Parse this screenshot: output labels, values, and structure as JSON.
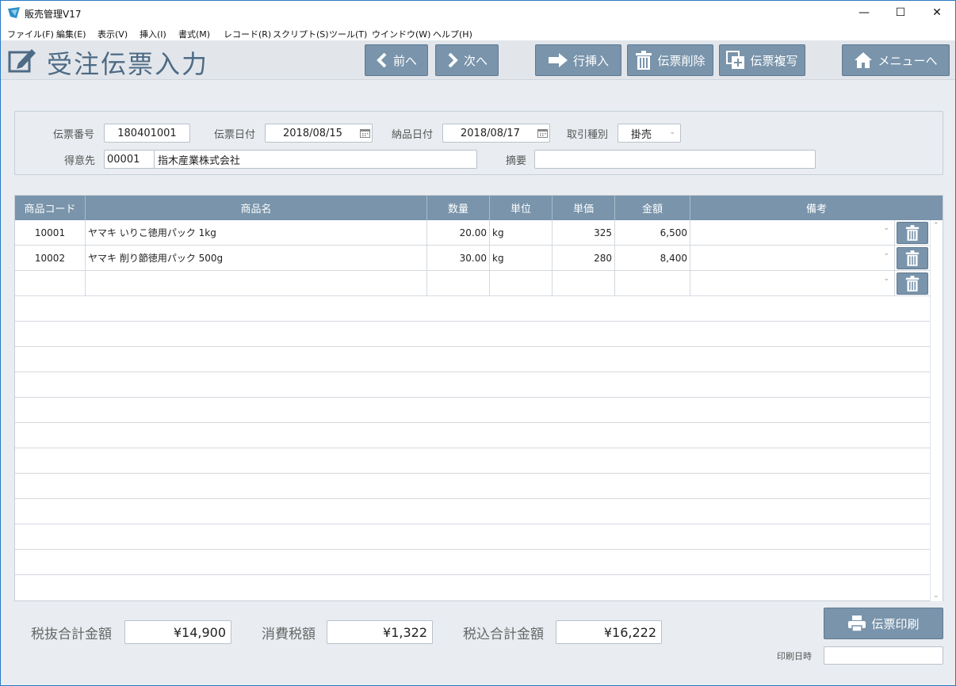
{
  "window": {
    "title": "販売管理V17",
    "minimize_glyph": "—",
    "maximize_glyph": "☐",
    "close_glyph": "✕"
  },
  "menu": [
    "ファイル(F)",
    "編集(E)",
    "表示(V)",
    "挿入(I)",
    "書式(M)",
    "レコード(R)",
    "スクリプト(S)",
    "ツール(T)",
    "ウインドウ(W)",
    "ヘルプ(H)"
  ],
  "header": {
    "title": "受注伝票入力",
    "prev_label": "前へ",
    "next_label": "次へ",
    "insert_row_label": "行挿入",
    "delete_slip_label": "伝票削除",
    "copy_slip_label": "伝票複写",
    "menu_label": "メニューへ"
  },
  "form": {
    "slip_no_label": "伝票番号",
    "slip_no": "180401001",
    "slip_date_label": "伝票日付",
    "slip_date": "2018/08/15",
    "delivery_date_label": "納品日付",
    "delivery_date": "2018/08/17",
    "trade_type_label": "取引種別",
    "trade_type": "掛売",
    "customer_label": "得意先",
    "customer_code": "00001",
    "customer_name": "指木産業株式会社",
    "memo_label": "摘要",
    "memo": ""
  },
  "grid": {
    "columns": [
      "商品コード",
      "商品名",
      "数量",
      "単位",
      "単価",
      "金額",
      "備考"
    ],
    "rows": [
      {
        "code": "10001",
        "name": "ヤマキ いりこ徳用パック 1kg",
        "qty": "20.00",
        "unit": "kg",
        "price": "325",
        "amount": "6,500",
        "note": ""
      },
      {
        "code": "10002",
        "name": "ヤマキ 削り節徳用パック 500g",
        "qty": "30.00",
        "unit": "kg",
        "price": "280",
        "amount": "8,400",
        "note": ""
      },
      {
        "code": "",
        "name": "",
        "qty": "",
        "unit": "",
        "price": "",
        "amount": "",
        "note": ""
      }
    ]
  },
  "totals": {
    "subtotal_label": "税抜合計金額",
    "subtotal": "¥14,900",
    "tax_label": "消費税額",
    "tax": "¥1,322",
    "total_label": "税込合計金額",
    "total": "¥16,222"
  },
  "print": {
    "button_label": "伝票印刷",
    "printed_at_label": "印刷日時",
    "printed_at": ""
  },
  "colors": {
    "accent": "#7994ab",
    "title_text": "#4e6b85",
    "background": "#e9edf1"
  }
}
